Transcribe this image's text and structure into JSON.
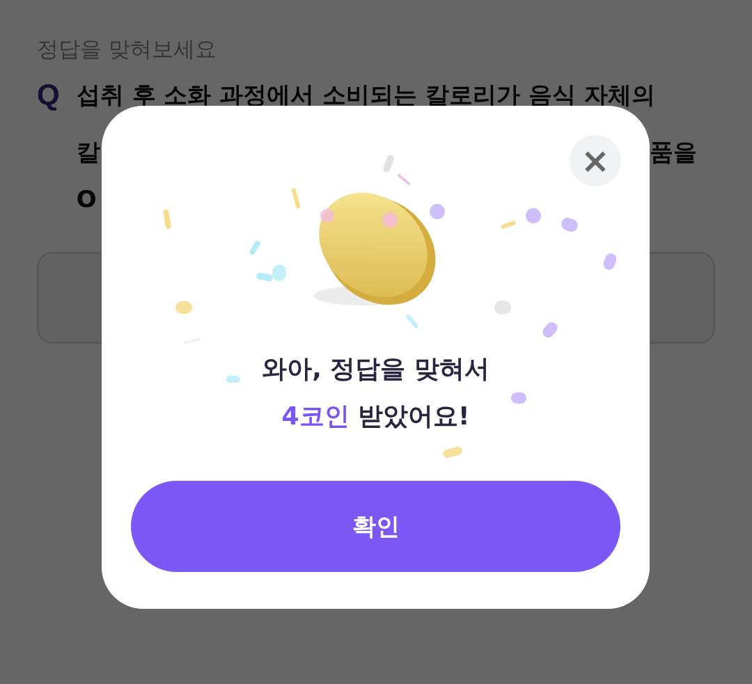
{
  "page": {
    "heading": "정답을 맞혀보세요",
    "question_mark": "Q",
    "question_lines": [
      {
        "parts": [
          "섭취 후 소화 과정에서 소비되는 칼로리가 음식 자체의"
        ]
      },
      {
        "parts": [
          "칼",
          "품을"
        ]
      },
      {
        "parts": [
          "O"
        ]
      }
    ]
  },
  "dialog": {
    "close_icon": "×",
    "message": {
      "line_1": "와아, 정답을 맞혀서",
      "highlight": "4코인",
      "line_2_rest": " 받았어요!"
    },
    "confirm_button": "확인"
  }
}
